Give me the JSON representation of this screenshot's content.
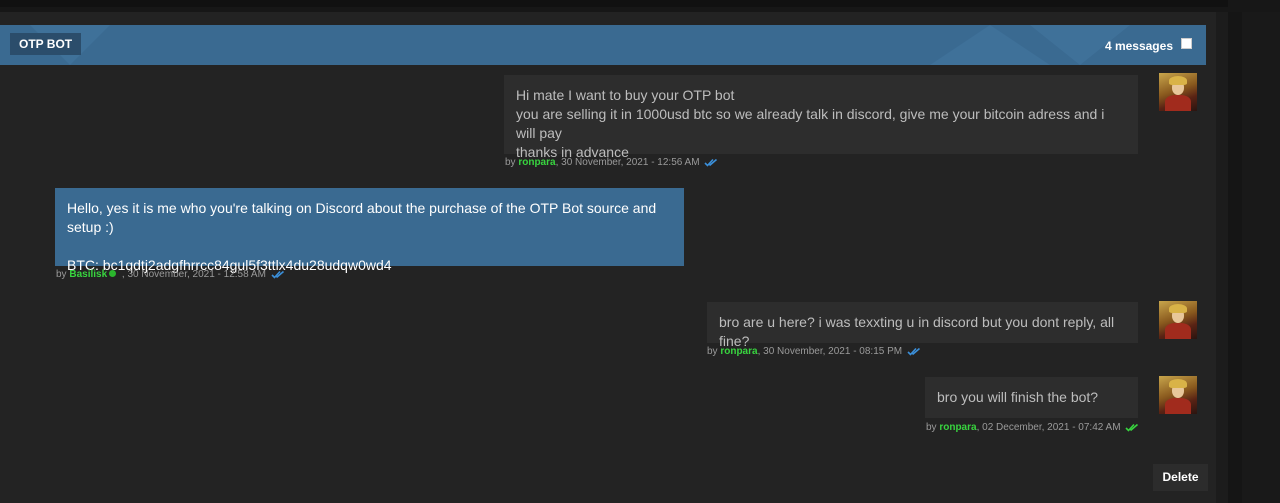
{
  "conversation": {
    "title": "OTP BOT",
    "message_count": "4 messages"
  },
  "messages": [
    {
      "direction": "out",
      "text": "Hi mate I want to buy your OTP bot\nyou are selling it in 1000usd btc so we already talk in discord, give me your bitcoin adress and i will pay\nthanks in advance",
      "by": "by",
      "user": "ronpara",
      "time": ", 30 November, 2021 - 12:56 AM",
      "read_color": "#3b8fd9"
    },
    {
      "direction": "in",
      "text": "Hello, yes it is me who you're talking on Discord about the purchase of the OTP Bot source and setup :)\n\nBTC: bc1qdtj2adgfhrrcc84gul5f3ttlx4du28udqw0wd4",
      "by": "by",
      "user": "Basilisk",
      "time": " , 30 November, 2021 - 12:58 AM",
      "read_color": "#3b8fd9"
    },
    {
      "direction": "out",
      "text": "bro are u here? i was texxting u in discord but you dont reply, all fine?",
      "by": "by",
      "user": "ronpara",
      "time": ", 30 November, 2021 - 08:15 PM",
      "read_color": "#3b8fd9"
    },
    {
      "direction": "out",
      "text": "bro you will finish the bot?",
      "by": "by",
      "user": "ronpara",
      "time": ", 02 December, 2021 - 07:42 AM",
      "read_color": "#38d43f"
    }
  ],
  "actions": {
    "delete_label": "Delete"
  },
  "colors": {
    "header": "#3a6a91",
    "username": "#38d43f"
  }
}
